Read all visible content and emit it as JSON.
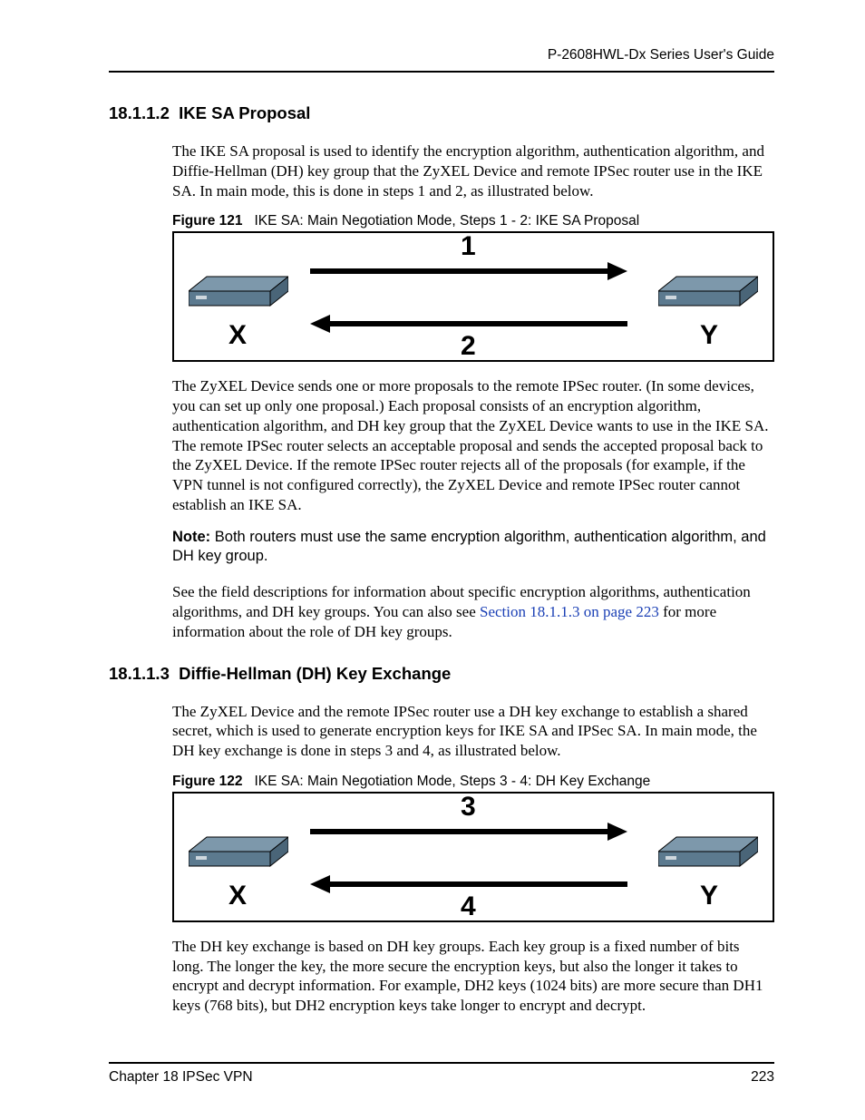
{
  "header": {
    "guide_title": "P-2608HWL-Dx Series User's Guide"
  },
  "section1": {
    "number": "18.1.1.2",
    "title": "IKE SA Proposal",
    "para1": "The IKE SA proposal is used to identify the encryption algorithm, authentication algorithm, and Diffie-Hellman (DH) key group that the ZyXEL Device and remote IPSec router use in the IKE SA. In main mode, this is done in steps 1 and 2, as illustrated below.",
    "fig_label": "Figure 121",
    "fig_caption": "IKE SA: Main Negotiation Mode, Steps 1 - 2: IKE SA Proposal",
    "fig": {
      "left_label": "X",
      "right_label": "Y",
      "top_num": "1",
      "bottom_num": "2"
    },
    "para2": "The ZyXEL Device sends one or more proposals to the remote IPSec router. (In some devices, you can set up only one proposal.) Each proposal consists of an encryption algorithm, authentication algorithm, and DH key group that the ZyXEL Device wants to use in the IKE SA. The remote IPSec router selects an acceptable proposal and sends the accepted proposal back to the ZyXEL Device. If the remote IPSec router rejects all of the proposals (for example, if the VPN tunnel is not configured correctly), the ZyXEL Device and remote IPSec router cannot establish an IKE SA.",
    "note_label": "Note:",
    "note_text": "Both routers must use the same encryption algorithm, authentication algorithm, and DH key group.",
    "para3_a": "See the field descriptions for information about specific encryption algorithms, authentication algorithms, and DH key groups. You can also see ",
    "para3_link": "Section 18.1.1.3 on page 223",
    "para3_b": " for more information about the role of DH key groups."
  },
  "section2": {
    "number": "18.1.1.3",
    "title": "Diffie-Hellman (DH) Key Exchange",
    "para1": "The ZyXEL Device and the remote IPSec router use a DH key exchange to establish a shared secret, which is used to generate encryption keys for IKE SA and IPSec SA. In main mode, the DH key exchange is done in steps 3 and 4, as illustrated below.",
    "fig_label": "Figure 122",
    "fig_caption": "IKE SA: Main Negotiation Mode, Steps 3 - 4: DH Key Exchange",
    "fig": {
      "left_label": "X",
      "right_label": "Y",
      "top_num": "3",
      "bottom_num": "4"
    },
    "para2": "The DH key exchange is based on DH key groups. Each key group is a fixed number of bits long. The longer the key, the more secure the encryption keys, but also the longer it takes to encrypt and decrypt information. For example, DH2 keys (1024 bits) are more secure than DH1 keys (768 bits), but DH2 encryption keys take longer to encrypt and decrypt."
  },
  "footer": {
    "chapter": "Chapter 18 IPSec VPN",
    "page": "223"
  }
}
